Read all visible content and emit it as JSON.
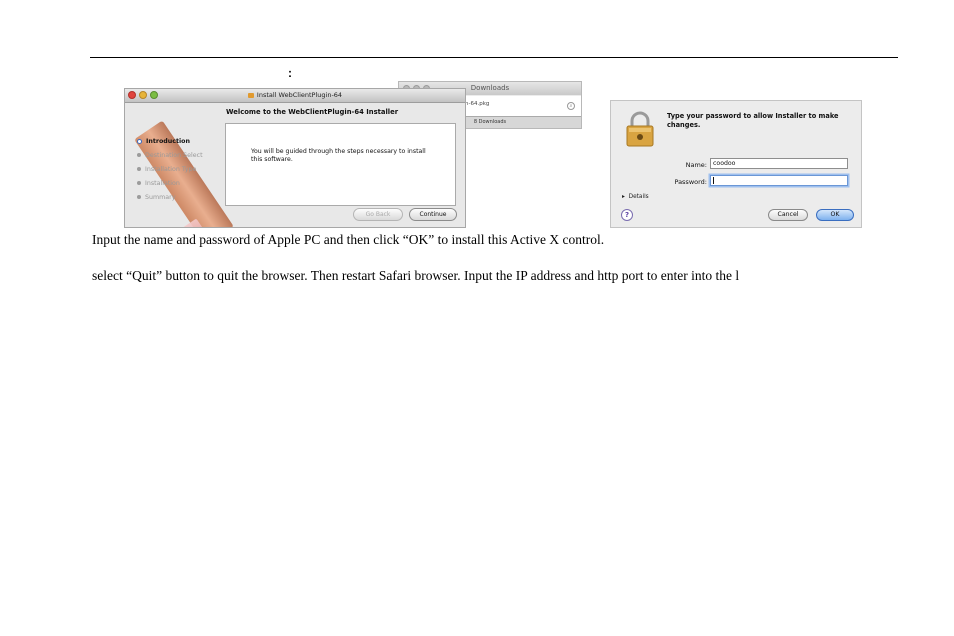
{
  "doc": {
    "colon": ":",
    "paragraph1": "Input the name and password of Apple PC and then click “OK” to install this Active X control.",
    "paragraph2": "select “Quit” button to quit the browser. Then restart Safari browser. Input the IP address and http port to enter into the l"
  },
  "downloads": {
    "title": "Downloads",
    "filename": "n-64.pkg",
    "footer": "8 Downloads"
  },
  "installer": {
    "title": "Install WebClientPlugin-64",
    "heading": "Welcome to the WebClientPlugin-64 Installer",
    "steps": [
      {
        "label": "Introduction",
        "active": true
      },
      {
        "label": "Destination Select",
        "active": false
      },
      {
        "label": "Installation Type",
        "active": false
      },
      {
        "label": "Installation",
        "active": false
      },
      {
        "label": "Summary",
        "active": false
      }
    ],
    "body": "You will be guided through the steps necessary to install this software.",
    "go_back": "Go Back",
    "continue": "Continue"
  },
  "auth": {
    "message": "Type your password to allow Installer to make changes.",
    "name_label": "Name:",
    "name_value": "coodoo",
    "password_label": "Password:",
    "password_value": "",
    "details": "Details",
    "help": "?",
    "cancel": "Cancel",
    "ok": "OK"
  }
}
